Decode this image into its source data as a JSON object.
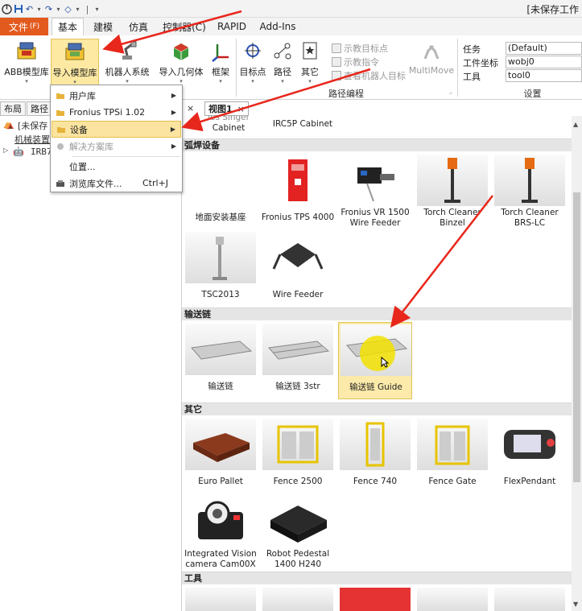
{
  "window": {
    "title": "[未保存工作"
  },
  "qat": {
    "save": "💾",
    "undo": "↶",
    "undo_dd": "▾",
    "redo": "↷",
    "redo_dd": "▾",
    "tool": "◇",
    "tool_dd": "▾",
    "customize": "▾"
  },
  "tabs": {
    "file": "文件",
    "file_key": "(F)",
    "items": [
      "基本",
      "建模",
      "仿真",
      "控制器(C)",
      "RAPID",
      "Add-Ins"
    ]
  },
  "ribbon": {
    "abb_library": "ABB模型库",
    "import_library": "导入模型库",
    "robot_system": "机器人系统",
    "import_geometry": "导入几何体",
    "frame": "框架",
    "target": "目标点",
    "path": "路径",
    "other": "其它",
    "show_target": "示教目标点",
    "show_instruction": "示教指令",
    "view_robot_target": "查看机器人目标",
    "multimove": "MultiMove",
    "path_group_label": "路径编程",
    "settings": {
      "task_label": "任务",
      "task_value": "(Default)",
      "wobj_label": "工件坐标",
      "wobj_value": "wobj0",
      "tool_label": "工具",
      "tool_value": "tool0",
      "group_label": "设置"
    }
  },
  "left_panel": {
    "tabs": [
      "布局",
      "路径"
    ],
    "tree": [
      "[未保存",
      "机械装置",
      "IRB7"
    ]
  },
  "doc_tab": {
    "close": "×",
    "view": "视图1",
    "view_close": "×"
  },
  "dropdown": {
    "items": [
      {
        "label": "用户库",
        "arrow": "▶"
      },
      {
        "label": "Fronius TPSi 1.02",
        "arrow": "▶"
      },
      {
        "label": "设备",
        "arrow": "▶"
      },
      {
        "label": "解决方案库",
        "arrow": "▶"
      },
      {
        "label": "位置..."
      },
      {
        "label": "浏览库文件...",
        "shortcut": "Ctrl+J"
      }
    ]
  },
  "gallery": {
    "top_labels": [
      "Cabinet",
      "IRC5P Cabinet"
    ],
    "top_partial": "les Singer",
    "sections": [
      {
        "title": "弧焊设备",
        "items": [
          "地面安装基座",
          "Fronius TPS 4000",
          "Fronius VR 1500\nWire Feeder",
          "Torch Cleaner\nBinzel",
          "Torch Cleaner\nBRS-LC",
          "TSC2013",
          "Wire Feeder"
        ]
      },
      {
        "title": "输送链",
        "items": [
          "输送链",
          "输送链 3str",
          "输送链 Guide"
        ]
      },
      {
        "title": "其它",
        "items": [
          "Euro Pallet",
          "Fence 2500",
          "Fence 740",
          "Fence Gate",
          "FlexPendant",
          "Integrated Vision\ncamera Cam00X",
          "Robot Pedestal\n1400 H240"
        ]
      },
      {
        "title": "工具",
        "items": []
      }
    ]
  },
  "colors": {
    "file_tab": "#e35a1e",
    "highlight": "#fbe4a0",
    "arrow": "#e8271c",
    "section_bg": "#e5e5e5"
  }
}
